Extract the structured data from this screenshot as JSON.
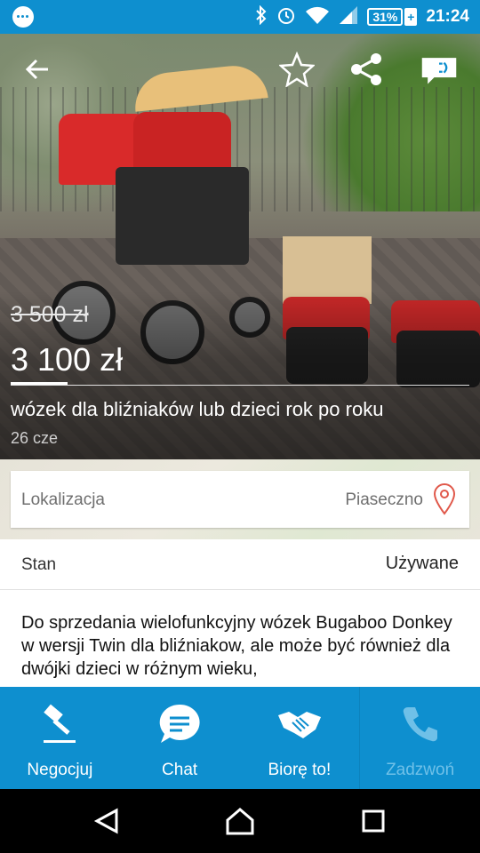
{
  "status_bar": {
    "battery": "31%",
    "time": "21:24"
  },
  "listing": {
    "old_price": "3 500 zł",
    "price": "3 100 zł",
    "title": "wózek dla bliźniaków lub dzieci rok po roku",
    "date": "26  cze"
  },
  "location": {
    "label": "Lokalizacja",
    "value": "Piaseczno"
  },
  "condition": {
    "label": "Stan",
    "value": "Używane"
  },
  "description": "Do sprzedania wielofunkcyjny wózek Bugaboo Donkey w wersji Twin dla bliźniakow, ale może być również dla dwójki dzieci w różnym wieku,",
  "actions": [
    {
      "label": "Negocjuj",
      "icon": "gavel-icon"
    },
    {
      "label": "Chat",
      "icon": "chat-icon"
    },
    {
      "label": "Biorę to!",
      "icon": "handshake-icon"
    },
    {
      "label": "Zadzwoń",
      "icon": "phone-icon"
    }
  ],
  "colors": {
    "accent": "#0e8fcf",
    "disabled": "#6fc0e8"
  }
}
